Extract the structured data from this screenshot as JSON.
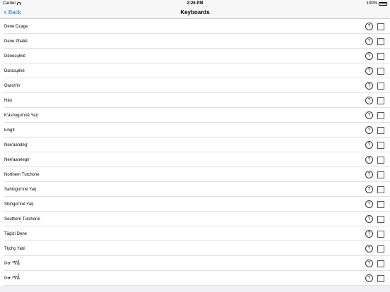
{
  "status_bar": {
    "carrier": "Carrier",
    "time": "2:26 PM",
    "battery": "100%"
  },
  "nav": {
    "back_label": "Back",
    "title": "Keyboards"
  },
  "keyboards": [
    "Dene Dzage",
    "Dene Zhatié",
    "Dënesųłiné",
    "Dɛnɛsųłiné",
    "Gwich'in",
    "Hän",
    "K'áshogot'ıné Yatı̨",
    "Łingít",
    "Nee'aandèg'",
    "Nee'aaneegn'",
    "Northern Tutchone",
    "Sahtúgot'ıné Yatı̨",
    "Shihgot'ıné Yatı̨",
    "Southern Tutchone",
    "Tāgizi Dene",
    "Tłı̨chǫ Yatıì",
    "ᐅᓂ ᐦᐁᐂ",
    "ᐅᓂ ᐦᐁᐂ"
  ],
  "help_glyph": "?"
}
